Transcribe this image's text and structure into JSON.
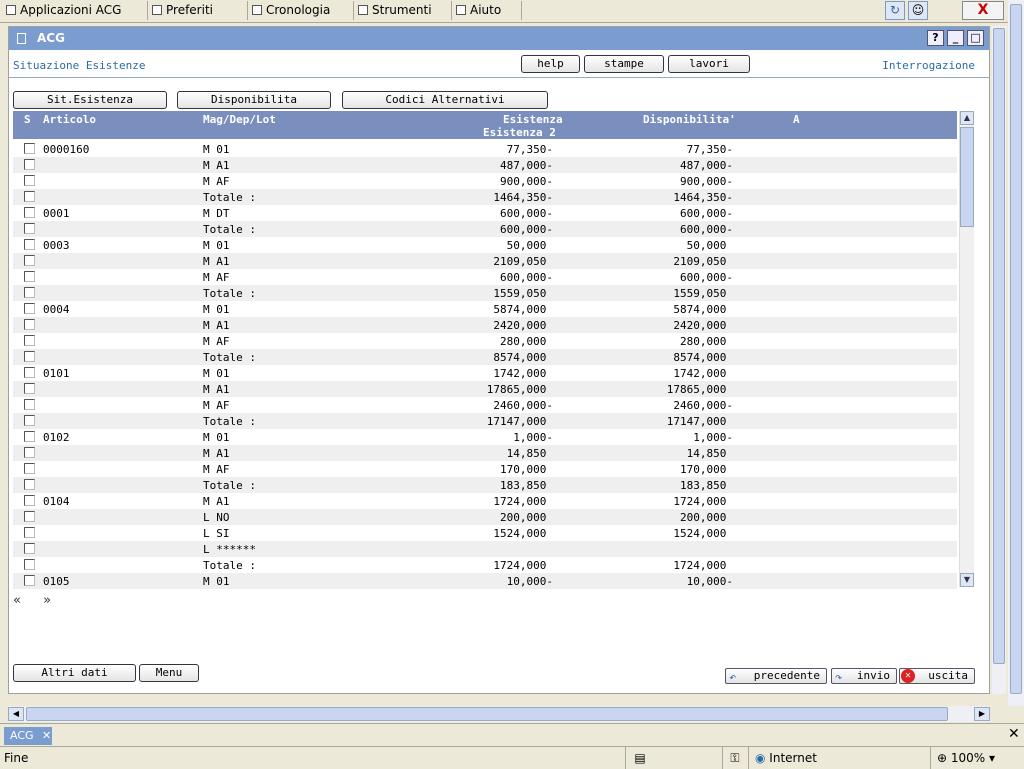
{
  "browser_menu": {
    "items": [
      "Applicazioni ACG",
      "Preferiti",
      "Cronologia",
      "Strumenti",
      "Aiuto"
    ],
    "close": "X"
  },
  "app": {
    "title": "ACG",
    "help_button": "?",
    "subtitle": "Situazione Esistenze",
    "mode": "Interrogazione",
    "top_buttons": {
      "help": "help",
      "stampe": "stampe",
      "lavori": "lavori"
    },
    "view_buttons": {
      "sit_esistenza": "Sit.Esistenza",
      "disponibilita": "Disponibilita",
      "codici_alternativi": "Codici Alternativi"
    },
    "columns": {
      "s": "S",
      "articolo": "Articolo",
      "mag": "Mag/Dep/Lot",
      "esistenza": "Esistenza",
      "esistenza2": "Esistenza 2",
      "disponibilita": "Disponibilita'",
      "a": "A"
    },
    "rows": [
      {
        "art": "0000160",
        "mag": "M 01",
        "esi": "77,350-",
        "dis": "77,350-"
      },
      {
        "art": "",
        "mag": "M A1",
        "esi": "487,000-",
        "dis": "487,000-"
      },
      {
        "art": "",
        "mag": "M AF",
        "esi": "900,000-",
        "dis": "900,000-"
      },
      {
        "art": "",
        "mag": "Totale :",
        "esi": "1464,350-",
        "dis": "1464,350-"
      },
      {
        "art": "0001",
        "mag": "M DT",
        "esi": "600,000-",
        "dis": "600,000-"
      },
      {
        "art": "",
        "mag": "Totale :",
        "esi": "600,000-",
        "dis": "600,000-"
      },
      {
        "art": "0003",
        "mag": "M 01",
        "esi": "50,000 ",
        "dis": "50,000 "
      },
      {
        "art": "",
        "mag": "M A1",
        "esi": "2109,050 ",
        "dis": "2109,050 "
      },
      {
        "art": "",
        "mag": "M AF",
        "esi": "600,000-",
        "dis": "600,000-"
      },
      {
        "art": "",
        "mag": "Totale :",
        "esi": "1559,050 ",
        "dis": "1559,050 "
      },
      {
        "art": "0004",
        "mag": "M 01",
        "esi": "5874,000 ",
        "dis": "5874,000 "
      },
      {
        "art": "",
        "mag": "M A1",
        "esi": "2420,000 ",
        "dis": "2420,000 "
      },
      {
        "art": "",
        "mag": "M AF",
        "esi": "280,000 ",
        "dis": "280,000 "
      },
      {
        "art": "",
        "mag": "Totale :",
        "esi": "8574,000 ",
        "dis": "8574,000 "
      },
      {
        "art": "0101",
        "mag": "M 01",
        "esi": "1742,000 ",
        "dis": "1742,000 "
      },
      {
        "art": "",
        "mag": "M A1",
        "esi": "17865,000 ",
        "dis": "17865,000 "
      },
      {
        "art": "",
        "mag": "M AF",
        "esi": "2460,000-",
        "dis": "2460,000-"
      },
      {
        "art": "",
        "mag": "Totale :",
        "esi": "17147,000 ",
        "dis": "17147,000 "
      },
      {
        "art": "0102",
        "mag": "M 01",
        "esi": "1,000-",
        "dis": "1,000-"
      },
      {
        "art": "",
        "mag": "M A1",
        "esi": "14,850 ",
        "dis": "14,850 "
      },
      {
        "art": "",
        "mag": "M AF",
        "esi": "170,000 ",
        "dis": "170,000 "
      },
      {
        "art": "",
        "mag": "Totale :",
        "esi": "183,850 ",
        "dis": "183,850 "
      },
      {
        "art": "0104",
        "mag": "M A1",
        "esi": "1724,000 ",
        "dis": "1724,000 "
      },
      {
        "art": "",
        "mag": "L NO",
        "esi": "200,000 ",
        "dis": "200,000 "
      },
      {
        "art": "",
        "mag": "L SI",
        "esi": "1524,000 ",
        "dis": "1524,000 "
      },
      {
        "art": "",
        "mag": "L ******",
        "esi": "",
        "dis": ""
      },
      {
        "art": "",
        "mag": "Totale :",
        "esi": "1724,000 ",
        "dis": "1724,000 "
      },
      {
        "art": "0105",
        "mag": "M 01",
        "esi": "10,000-",
        "dis": "10,000-"
      }
    ],
    "pager": {
      "prev": "«",
      "next": "»"
    },
    "bottom_buttons": {
      "altri_dati": "Altri dati",
      "menu": "Menu"
    },
    "nav_buttons": {
      "precedente": "precedente",
      "invio": "invio",
      "uscita": "uscita"
    }
  },
  "tabbar": {
    "tab": "ACG",
    "tab_close": "✕",
    "close_all": "✕"
  },
  "statusbar": {
    "status": "Fine",
    "zone": "Internet",
    "zoom": "100%"
  },
  "colors": {
    "accent": "#7b9ccf",
    "header": "#7b8fbf",
    "label": "#2a6ca7"
  }
}
